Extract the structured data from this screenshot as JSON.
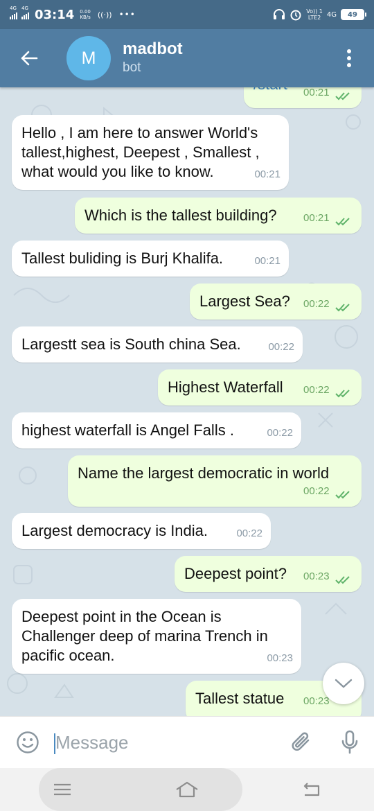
{
  "status_bar": {
    "network1": "4G",
    "network2": "4G",
    "time": "03:14",
    "speed_value": "0.00",
    "speed_unit": "KB/s",
    "volte": "Vo)) 1",
    "lte": "LTE2",
    "net_right": "4G",
    "battery": "49"
  },
  "header": {
    "avatar_letter": "M",
    "title": "madbot",
    "subtitle": "bot"
  },
  "messages": [
    {
      "dir": "out",
      "text": "/start",
      "time": "00:21"
    },
    {
      "dir": "in",
      "text": "Hello , I am here to answer World's\ntallest,highest, Deepest , Smallest ,\nwhat would  you like to know.",
      "time": "00:21"
    },
    {
      "dir": "out",
      "text": "Which is the tallest building?",
      "time": "00:21"
    },
    {
      "dir": "in",
      "text": "Tallest buliding is Burj Khalifa.",
      "time": "00:21"
    },
    {
      "dir": "out",
      "text": "Largest Sea?",
      "time": "00:22"
    },
    {
      "dir": "in",
      "text": "Largestt sea is South china Sea.",
      "time": "00:22"
    },
    {
      "dir": "out",
      "text": "Highest Waterfall",
      "time": "00:22"
    },
    {
      "dir": "in",
      "text": "highest waterfall is Angel Falls .",
      "time": "00:22"
    },
    {
      "dir": "out",
      "text": "Name the largest democratic in world",
      "time": "00:22"
    },
    {
      "dir": "in",
      "text": "Largest democracy is India.",
      "time": "00:22"
    },
    {
      "dir": "out",
      "text": "Deepest point?",
      "time": "00:23"
    },
    {
      "dir": "in",
      "text": "Deepest point in the Ocean is\nChallenger deep of marina Trench in\npacific ocean.",
      "time": "00:23"
    },
    {
      "dir": "out",
      "text": "Tallest statue",
      "time": "00:23"
    }
  ],
  "input": {
    "placeholder": "Message"
  },
  "colors": {
    "status_bar": "#456a88",
    "header": "#517da2",
    "avatar": "#5fb7e8",
    "outgoing_bubble": "#efffde",
    "incoming_bubble": "#ffffff",
    "check_marks": "#5fb36a"
  },
  "icons": {
    "back": "arrow-left-icon",
    "menu": "more-vertical-icon",
    "emoji": "smile-icon",
    "attach": "paperclip-icon",
    "mic": "microphone-icon",
    "scroll": "chevron-down-icon",
    "nav_recents": "recents-icon",
    "nav_home": "home-icon",
    "nav_back": "nav-back-icon"
  }
}
